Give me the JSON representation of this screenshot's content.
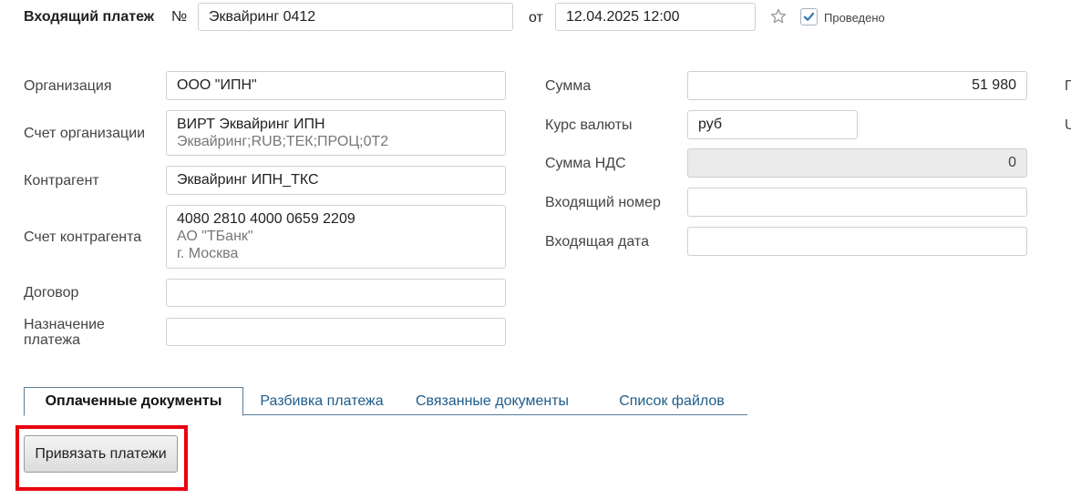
{
  "header": {
    "title": "Входящий платеж",
    "number_label": "№",
    "number_value": "Эквайринг 0412",
    "date_label": "от",
    "date_value": "12.04.2025 12:00",
    "posted_label": "Проведено",
    "posted_checked": true
  },
  "left": {
    "organization": {
      "label": "Организация",
      "value": "ООО \"ИПН\""
    },
    "org_account": {
      "label": "Счет организации",
      "line1": "ВИРТ Эквайринг ИПН",
      "line2": "Эквайринг;RUB;ТЕК;ПРОЦ;0Т2"
    },
    "counterparty": {
      "label": "Контрагент",
      "value": "Эквайринг ИПН_ТКС"
    },
    "counterparty_account": {
      "label": "Счет контрагента",
      "line1": "4080 2810 4000 0659 2209",
      "line2": "АО \"ТБанк\"",
      "line3": "г. Москва"
    },
    "contract": {
      "label": "Договор",
      "value": ""
    },
    "purpose": {
      "label_line1": "Назначение",
      "label_line2": "платежа",
      "value": ""
    }
  },
  "right": {
    "amount": {
      "label": "Сумма",
      "value": "51 980"
    },
    "rate": {
      "label": "Курс валюты",
      "value": "руб"
    },
    "vat": {
      "label": "Сумма НДС",
      "value": "0"
    },
    "incoming_number": {
      "label": "Входящий номер",
      "value": ""
    },
    "incoming_date": {
      "label": "Входящая дата",
      "value": ""
    }
  },
  "edge_labels": {
    "line1": "П",
    "line2": "U"
  },
  "tabs": [
    {
      "label": "Оплаченные документы"
    },
    {
      "label": "Разбивка платежа"
    },
    {
      "label": "Связанные документы"
    },
    {
      "label": "Список файлов"
    }
  ],
  "actions": {
    "bind_payments_label": "Привязать платежи"
  },
  "colors": {
    "highlight": "#e8000f",
    "accent": "#1f5c8b",
    "check": "#2a7ab8"
  }
}
